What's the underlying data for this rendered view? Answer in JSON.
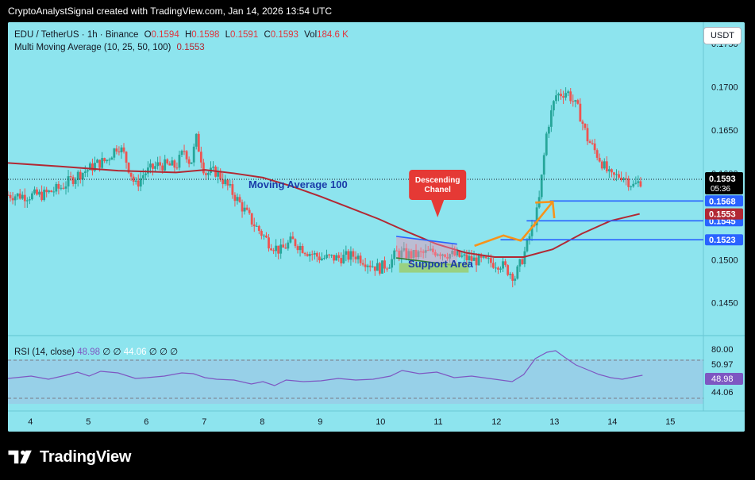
{
  "header": {
    "text": "CryptoAnalystSignal created with TradingView.com, Jan 14, 2026 13:54 UTC"
  },
  "legend": {
    "symbol": "EDU / TetherUS · 1h · Binance",
    "open_label": "O",
    "open": "0.1594",
    "high_label": "H",
    "high": "0.1598",
    "low_label": "L",
    "low": "0.1591",
    "close_label": "C",
    "close": "0.1593",
    "vol_label": "Vol",
    "vol": "184.6 K",
    "ma_label": "Multi Moving Average (10, 25, 50, 100)",
    "ma_value": "0.1553"
  },
  "rsi_legend": {
    "label": "RSI (14, close)",
    "value": "48.98",
    "value2": "44.06",
    "empty": "∅"
  },
  "currency_button": "USDT",
  "footer": {
    "logo_text": "TradingView"
  },
  "colors": {
    "panel_bg": "#8de4ee",
    "bull": "#26a69a",
    "bear": "#ef5350",
    "ma": "#b22833",
    "rsi": "#7e57c2",
    "level_line": "#2962ff",
    "arrow": "#f7931a",
    "background": "#000000"
  },
  "chart_data": [
    {
      "type": "candlestick",
      "title": "EDU / TetherUS · 1h · Binance",
      "ylim": [
        0.1435,
        0.1775
      ],
      "y_ticks": [
        "0.1750",
        "0.1700",
        "0.1650",
        "0.1600",
        "0.1550",
        "0.1500",
        "0.1450"
      ],
      "x_ticks": [
        "4",
        "5",
        "6",
        "7",
        "8",
        "9",
        "10",
        "11",
        "12",
        "13",
        "14",
        "15"
      ],
      "x_range_days": [
        3.6,
        15.6
      ],
      "price_path": [
        [
          3.6,
          0.1575
        ],
        [
          3.9,
          0.1574
        ],
        [
          4.2,
          0.1575
        ],
        [
          4.5,
          0.1583
        ],
        [
          4.8,
          0.1598
        ],
        [
          5.0,
          0.1605
        ],
        [
          5.1,
          0.161
        ],
        [
          5.3,
          0.1615
        ],
        [
          5.5,
          0.1633
        ],
        [
          5.6,
          0.1622
        ],
        [
          5.8,
          0.1585
        ],
        [
          5.95,
          0.16
        ],
        [
          6.2,
          0.161
        ],
        [
          6.5,
          0.1608
        ],
        [
          6.65,
          0.1628
        ],
        [
          6.75,
          0.161
        ],
        [
          6.85,
          0.164
        ],
        [
          7.0,
          0.16
        ],
        [
          7.2,
          0.1602
        ],
        [
          7.5,
          0.1575
        ],
        [
          7.8,
          0.1545
        ],
        [
          8.1,
          0.152
        ],
        [
          8.3,
          0.151
        ],
        [
          8.5,
          0.1522
        ],
        [
          8.8,
          0.1508
        ],
        [
          9.0,
          0.1502
        ],
        [
          9.3,
          0.1502
        ],
        [
          9.6,
          0.1505
        ],
        [
          9.85,
          0.1495
        ],
        [
          10.0,
          0.149
        ],
        [
          10.2,
          0.1497
        ],
        [
          10.3,
          0.1508
        ],
        [
          10.6,
          0.1505
        ],
        [
          11.0,
          0.151
        ],
        [
          11.3,
          0.1505
        ],
        [
          11.6,
          0.15
        ],
        [
          11.9,
          0.1497
        ],
        [
          12.1,
          0.1495
        ],
        [
          12.35,
          0.148
        ],
        [
          12.5,
          0.1505
        ],
        [
          12.75,
          0.156
        ],
        [
          12.9,
          0.165
        ],
        [
          13.05,
          0.169
        ],
        [
          13.25,
          0.1695
        ],
        [
          13.45,
          0.1672
        ],
        [
          13.6,
          0.164
        ],
        [
          13.8,
          0.1618
        ],
        [
          14.0,
          0.1595
        ],
        [
          14.2,
          0.1598
        ],
        [
          14.4,
          0.1585
        ],
        [
          14.55,
          0.1593
        ]
      ],
      "ma100": [
        [
          3.6,
          0.1612
        ],
        [
          4.5,
          0.1608
        ],
        [
          5.5,
          0.1603
        ],
        [
          6.5,
          0.1601
        ],
        [
          7.0,
          0.1604
        ],
        [
          7.5,
          0.16
        ],
        [
          8.0,
          0.1595
        ],
        [
          8.5,
          0.1585
        ],
        [
          9.0,
          0.1573
        ],
        [
          9.5,
          0.156
        ],
        [
          10.0,
          0.1547
        ],
        [
          10.5,
          0.1532
        ],
        [
          11.0,
          0.1518
        ],
        [
          11.5,
          0.1508
        ],
        [
          12.0,
          0.1503
        ],
        [
          12.5,
          0.1503
        ],
        [
          13.0,
          0.1512
        ],
        [
          13.5,
          0.153
        ],
        [
          14.0,
          0.1545
        ],
        [
          14.5,
          0.1553
        ]
      ],
      "annotations": [
        {
          "text": "Moving Average 100",
          "x": 7.75,
          "y": 0.1583
        },
        {
          "text": "Descending Chanel",
          "x": 11.0,
          "y": 0.1582
        },
        {
          "text": "Support Area",
          "x": 10.45,
          "y": 0.149
        }
      ],
      "levels": [
        {
          "value": 0.1568,
          "label": "0.1568",
          "from": 12.95
        },
        {
          "value": 0.1545,
          "label": "0.1545",
          "from": 12.55
        },
        {
          "value": 0.1523,
          "label": "0.1523",
          "from": 12.1
        }
      ],
      "price_tags": [
        {
          "label": "0.1593",
          "sub": "05:36",
          "value": 0.1593,
          "kind": "last"
        },
        {
          "label": "0.1553",
          "value": 0.1553,
          "kind": "ma"
        }
      ],
      "projection_arrow": [
        [
          11.65,
          0.1516
        ],
        [
          12.15,
          0.1528
        ],
        [
          12.45,
          0.1522
        ],
        [
          12.65,
          0.1538
        ],
        [
          13.0,
          0.1567
        ],
        [
          13.05,
          0.1562
        ],
        [
          13.05,
          0.155
        ]
      ]
    },
    {
      "type": "line",
      "title": "RSI (14, close)",
      "ylim": [
        0,
        100
      ],
      "y_ticks": [
        "80.00",
        "50.97",
        "48.98",
        "44.06"
      ],
      "rsi_path": [
        [
          3.6,
          45
        ],
        [
          4.0,
          48
        ],
        [
          4.3,
          44
        ],
        [
          4.6,
          49
        ],
        [
          4.8,
          53
        ],
        [
          5.0,
          48
        ],
        [
          5.2,
          54
        ],
        [
          5.5,
          52
        ],
        [
          5.8,
          45
        ],
        [
          6.0,
          46
        ],
        [
          6.3,
          48
        ],
        [
          6.6,
          52
        ],
        [
          6.8,
          51
        ],
        [
          7.0,
          46
        ],
        [
          7.2,
          44
        ],
        [
          7.5,
          43
        ],
        [
          7.8,
          38
        ],
        [
          8.0,
          41
        ],
        [
          8.2,
          36
        ],
        [
          8.4,
          43
        ],
        [
          8.7,
          41
        ],
        [
          9.0,
          42
        ],
        [
          9.3,
          45
        ],
        [
          9.6,
          43
        ],
        [
          9.9,
          44
        ],
        [
          10.2,
          48
        ],
        [
          10.4,
          55
        ],
        [
          10.7,
          51
        ],
        [
          11.0,
          53
        ],
        [
          11.3,
          46
        ],
        [
          11.6,
          48
        ],
        [
          11.9,
          45
        ],
        [
          12.1,
          43
        ],
        [
          12.3,
          41
        ],
        [
          12.5,
          50
        ],
        [
          12.7,
          70
        ],
        [
          12.9,
          78
        ],
        [
          13.05,
          80
        ],
        [
          13.2,
          72
        ],
        [
          13.4,
          62
        ],
        [
          13.6,
          56
        ],
        [
          13.8,
          50
        ],
        [
          14.0,
          46
        ],
        [
          14.2,
          44
        ],
        [
          14.4,
          47
        ],
        [
          14.55,
          49
        ]
      ],
      "overbought": 80,
      "oversold": 44.06,
      "mid": 50.97
    }
  ]
}
